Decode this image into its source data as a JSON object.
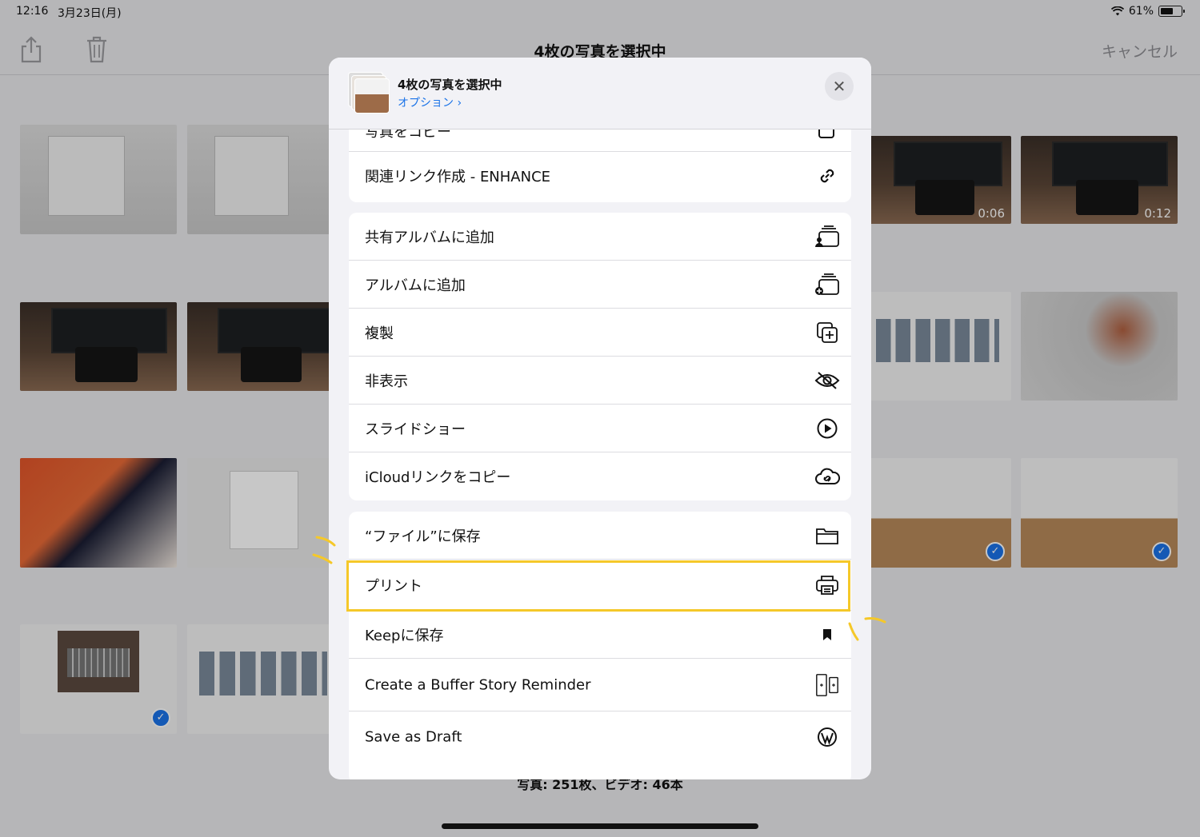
{
  "status_bar": {
    "time": "12:16",
    "date": "3月23日(月)",
    "battery": "61%",
    "battery_level": 0.61
  },
  "nav": {
    "title": "4枚の写真を選択中",
    "cancel": "キャンセル"
  },
  "grid": {
    "durations": [
      "0:06",
      "0:12"
    ]
  },
  "footer": {
    "count": "写真: 251枚、ビデオ: 46本"
  },
  "sheet": {
    "title": "4枚の写真を選択中",
    "options": "オプション ›",
    "close": "✕",
    "partial_label": "写真をコピー",
    "groups": [
      [
        {
          "label": "関連リンク作成 - ENHANCE",
          "icon": "link-icon"
        }
      ],
      [
        {
          "label": "共有アルバムに追加",
          "icon": "shared-album-icon"
        },
        {
          "label": "アルバムに追加",
          "icon": "add-album-icon"
        },
        {
          "label": "複製",
          "icon": "duplicate-icon"
        },
        {
          "label": "非表示",
          "icon": "hide-icon"
        },
        {
          "label": "スライドショー",
          "icon": "play-icon"
        },
        {
          "label": "iCloudリンクをコピー",
          "icon": "cloud-link-icon"
        }
      ],
      [
        {
          "label": "“ファイル”に保存",
          "icon": "folder-icon"
        },
        {
          "label": "プリント",
          "icon": "print-icon"
        },
        {
          "label": "Keepに保存",
          "icon": "bookmark-icon"
        },
        {
          "label": "Create a Buffer Story Reminder",
          "icon": "buffer-icon"
        },
        {
          "label": "Save as Draft",
          "icon": "wordpress-icon"
        }
      ]
    ]
  },
  "colors": {
    "accent": "#1a73e8",
    "highlight": "#f5c829"
  }
}
